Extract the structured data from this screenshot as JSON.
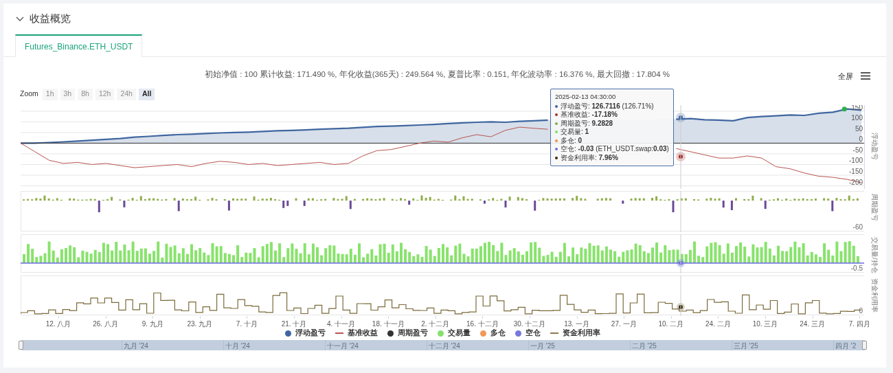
{
  "section": {
    "title": "收益概览",
    "expanded": true
  },
  "tabs": [
    {
      "label": "Futures_Binance.ETH_USDT",
      "selected": true
    }
  ],
  "stats": "初始净值 : 100 累计收益: 171.490 %, 年化收益(365天) : 249.564 %, 夏普比率 : 0.151, 年化波动率 : 16.376 %, 最大回撤 : 17.804 %",
  "fullscreen": "全屏",
  "zoom": {
    "label": "Zoom",
    "buttons": [
      {
        "label": "1h",
        "selected": false,
        "disabled": true
      },
      {
        "label": "3h",
        "selected": false,
        "disabled": true
      },
      {
        "label": "8h",
        "selected": false,
        "disabled": true
      },
      {
        "label": "12h",
        "selected": false,
        "disabled": true
      },
      {
        "label": "24h",
        "selected": false,
        "disabled": true
      },
      {
        "label": "All",
        "selected": true,
        "disabled": false
      }
    ]
  },
  "chart_data": {
    "type": "area",
    "grid": true,
    "legend": "bottom",
    "ylabel": "浮动盈亏",
    "ylim": [
      -208,
      172
    ],
    "yticks": [
      -200,
      -150,
      -100,
      -50,
      0,
      50,
      100,
      150
    ],
    "series": [
      {
        "name": "浮动盈亏",
        "type": "area",
        "color": "#3f66a0",
        "values": [
          0,
          0,
          3,
          6,
          10,
          14,
          18,
          22,
          28,
          32,
          36,
          40,
          42,
          45,
          48,
          50,
          52,
          55,
          58,
          60,
          62,
          65,
          68,
          70,
          74,
          78,
          80,
          82,
          85,
          88,
          92,
          95,
          98,
          100,
          98,
          102,
          105,
          108,
          null,
          null,
          null,
          null,
          null,
          null,
          null,
          null,
          112,
          115,
          110,
          108,
          105,
          120,
          125,
          128,
          132,
          130,
          140,
          145,
          160,
          155
        ]
      },
      {
        "name": "基准收益",
        "type": "line",
        "color": "#b85450",
        "values": [
          0,
          -40,
          -80,
          -95,
          -90,
          -100,
          -95,
          -105,
          -115,
          -110,
          -105,
          -100,
          -110,
          -95,
          -85,
          -90,
          -100,
          -95,
          -105,
          -100,
          -95,
          -90,
          -100,
          -95,
          -60,
          -35,
          -30,
          -15,
          0,
          10,
          5,
          25,
          40,
          30,
          60,
          75,
          70,
          65,
          null,
          null,
          null,
          null,
          null,
          null,
          null,
          null,
          -25,
          -40,
          -55,
          -70,
          -70,
          -60,
          -70,
          -110,
          -120,
          -140,
          -155,
          -160,
          -170,
          -185
        ]
      }
    ]
  },
  "panels": [
    {
      "title": "周期盈亏",
      "tick": "-60"
    },
    {
      "title": "交易量/持仓",
      "tick": "-0.5"
    },
    {
      "title": "资金利用率",
      "tick": "0"
    }
  ],
  "tooltip": {
    "time": "2025-02-13 04:30:00",
    "rows": [
      {
        "color": "#3f66a0",
        "label": "浮动盈亏:",
        "value": "126.7116",
        "extra": "(126.71%)"
      },
      {
        "color": "#b03030",
        "label": "基准收益:",
        "value": "-17.18%"
      },
      {
        "color": "#8aa84a",
        "label": "周期盈亏:",
        "value": "9.2828"
      },
      {
        "color": "#7ee06a",
        "label": "交易量:",
        "value": "1"
      },
      {
        "color": "#f0904a",
        "label": "多仓:",
        "value": "0"
      },
      {
        "color": "#7070e0",
        "label": "空仓:",
        "value": "-0.03",
        "extra": "(ETH_USDT.swap:**0.03**)"
      },
      {
        "color": "#3a2a10",
        "label": "资金利用率:",
        "value": "7.96%"
      }
    ]
  },
  "xaxis": [
    "12. 八月",
    "26. 八月",
    "9. 九月",
    "23. 九月",
    "7. 十月",
    "21. 十月",
    "4. 十一月",
    "18. 十一月",
    "2. 十二月",
    "16. 十二月",
    "30. 十二月",
    "13. 一月",
    "27. 一月",
    "10. 二月",
    "24. 二月",
    "10. 三月",
    "24. 三月",
    "7. 四月"
  ],
  "legend": [
    {
      "kind": "dot",
      "label": "周期盈亏",
      "color": "#333333"
    },
    {
      "kind": "dot",
      "label": "交易量",
      "color": "#86e06e"
    },
    {
      "kind": "dot",
      "label": "多仓",
      "color": "#f0995a"
    },
    {
      "kind": "dot",
      "label": "空仓",
      "color": "#7777dd"
    },
    {
      "kind": "line",
      "label": "资金利用率",
      "color": "#8a7c50"
    }
  ],
  "navigator": [
    "九月 '24",
    "十月 '24",
    "十一月 '24",
    "十二月 '24",
    "一月 '25",
    "二月 '25",
    "三月 '25",
    "四月 '2"
  ]
}
